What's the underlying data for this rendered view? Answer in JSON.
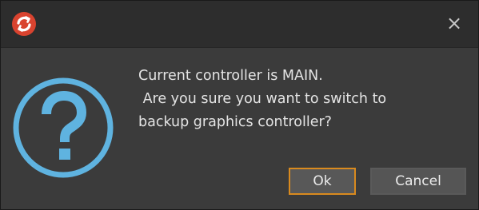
{
  "window": {
    "close_label": "×"
  },
  "message": {
    "text": "Current controller is MAIN.\n Are you sure you want to switch to\nbackup graphics controller?"
  },
  "buttons": {
    "ok_label": "Ok",
    "cancel_label": "Cancel"
  },
  "icons": {
    "app": "app-logo-icon",
    "question": "question-icon",
    "close": "close-icon"
  },
  "colors": {
    "accent_focus": "#d98a1e",
    "question_icon": "#5fb3e0",
    "app_icon_red": "#d9432f"
  }
}
